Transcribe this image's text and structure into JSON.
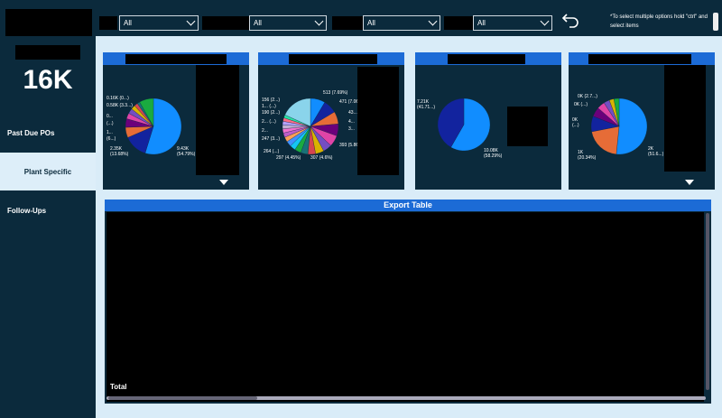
{
  "kpi": {
    "value": "16K"
  },
  "nav": {
    "items": [
      {
        "label": "Past Due POs"
      },
      {
        "label": "Plant Specific"
      },
      {
        "label": "Follow-Ups"
      }
    ]
  },
  "filters": [
    {
      "value": "All"
    },
    {
      "value": "All"
    },
    {
      "value": "All"
    },
    {
      "value": "All"
    }
  ],
  "hint": "*To select multiple options hold \"ctrl\" and select items",
  "icons": {
    "back": "undo-arrow-icon",
    "dropdown": "chevron-down-icon",
    "expand": "triangle-down-icon"
  },
  "colors": {
    "accent": "#1c6bd6",
    "background": "#0b2a3c",
    "canvas": "#d9ecf8"
  },
  "charts": [
    {
      "labels": [
        "0.16K (0...)",
        "0.58K (3.3...)",
        "0...",
        "(...)",
        "1...",
        "(6...)",
        "2.35K (13.68%)",
        "9.43K (54.79%)"
      ],
      "slices": [
        {
          "value": 54.79,
          "color": "#118dff"
        },
        {
          "value": 13.68,
          "color": "#12239e"
        },
        {
          "value": 6.0,
          "color": "#e66c37"
        },
        {
          "value": 5.0,
          "color": "#6b007b"
        },
        {
          "value": 3.3,
          "color": "#e044a7"
        },
        {
          "value": 3.0,
          "color": "#744ec2"
        },
        {
          "value": 2.5,
          "color": "#d9b300"
        },
        {
          "value": 2.0,
          "color": "#d64550"
        },
        {
          "value": 1.5,
          "color": "#197278"
        },
        {
          "value": 8.23,
          "color": "#1aab40"
        }
      ]
    },
    {
      "labels": [
        "156 (2...)",
        "1... (...)",
        "190 (2...)",
        "2... (...)",
        "2...",
        "247 (3...)",
        "264 (...)",
        "297 (4.45%)",
        "307 (4.6%)",
        "393 (5.86%)",
        "513 (7.69%)",
        "471 (7.06%)",
        "43...",
        "4...",
        "3..."
      ],
      "slices": [
        {
          "value": 7.69,
          "color": "#118dff"
        },
        {
          "value": 7.06,
          "color": "#12239e"
        },
        {
          "value": 6.5,
          "color": "#e66c37"
        },
        {
          "value": 6.2,
          "color": "#6b007b"
        },
        {
          "value": 5.86,
          "color": "#e044a7"
        },
        {
          "value": 4.6,
          "color": "#744ec2"
        },
        {
          "value": 4.45,
          "color": "#d9b300"
        },
        {
          "value": 4.0,
          "color": "#d64550"
        },
        {
          "value": 3.7,
          "color": "#197278"
        },
        {
          "value": 3.4,
          "color": "#1aab40"
        },
        {
          "value": 3.0,
          "color": "#15c6f4"
        },
        {
          "value": 2.8,
          "color": "#4092ff"
        },
        {
          "value": 2.5,
          "color": "#ffa058"
        },
        {
          "value": 2.3,
          "color": "#be5dc9"
        },
        {
          "value": 2.2,
          "color": "#f472d0"
        },
        {
          "value": 2.0,
          "color": "#c5b0d5"
        },
        {
          "value": 1.9,
          "color": "#b5a1ff"
        },
        {
          "value": 1.8,
          "color": "#ff6d86"
        },
        {
          "value": 1.6,
          "color": "#29e2a5"
        },
        {
          "value": 16.44,
          "color": "#8ad4eb"
        }
      ]
    },
    {
      "labels": [
        "7.21K (41.71...)",
        "10.08K (58.29%)"
      ],
      "slices": [
        {
          "value": 58.29,
          "color": "#118dff"
        },
        {
          "value": 41.71,
          "color": "#12239e"
        }
      ]
    },
    {
      "labels": [
        "0K (2.7...)",
        "0K (...)",
        "0K (...)",
        "1K (20.34%)",
        "2K (51.6...)"
      ],
      "slices": [
        {
          "value": 51.6,
          "color": "#118dff"
        },
        {
          "value": 20.34,
          "color": "#e66c37"
        },
        {
          "value": 9.0,
          "color": "#12239e"
        },
        {
          "value": 5.5,
          "color": "#6b007b"
        },
        {
          "value": 4.5,
          "color": "#e044a7"
        },
        {
          "value": 3.36,
          "color": "#744ec2"
        },
        {
          "value": 2.7,
          "color": "#d9b300"
        },
        {
          "value": 3.0,
          "color": "#1aab40"
        }
      ]
    }
  ],
  "table": {
    "title": "Export Table",
    "total_label": "Total"
  }
}
